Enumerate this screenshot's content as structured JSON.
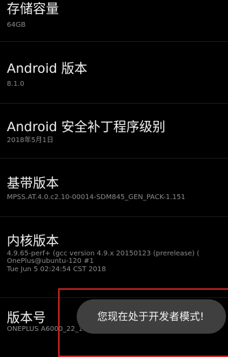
{
  "settings": {
    "items": [
      {
        "title": "存储容量",
        "lines": [
          "64GB"
        ]
      },
      {
        "title": "Android 版本",
        "lines": [
          "8.1.0"
        ]
      },
      {
        "title": "Android 安全补丁程序级别",
        "lines": [
          "2018年5月1日"
        ]
      },
      {
        "title": "基带版本",
        "lines": [
          "MPSS.AT.4.0.c2.10-00014-SDM845_GEN_PACK-1.151"
        ]
      },
      {
        "title": "内核版本",
        "lines": [
          "4.9.65-perf+ (gcc version 4.9.x 20150123 (prerelease) (",
          "OnePlus@ubuntu-120 #1",
          "Tue Jun 5 02:24:54 CST 2018"
        ]
      },
      {
        "title": "版本号",
        "lines": [
          "ONEPLUS A6000_22_180605"
        ]
      }
    ]
  },
  "toast": {
    "message": "您现在处于开发者模式!"
  },
  "colors": {
    "background": "#000000",
    "title_text": "#f2f2f2",
    "subtitle_text": "#8c8c8c",
    "toast_bg": "#3f3f3f",
    "highlight": "#d62626"
  }
}
